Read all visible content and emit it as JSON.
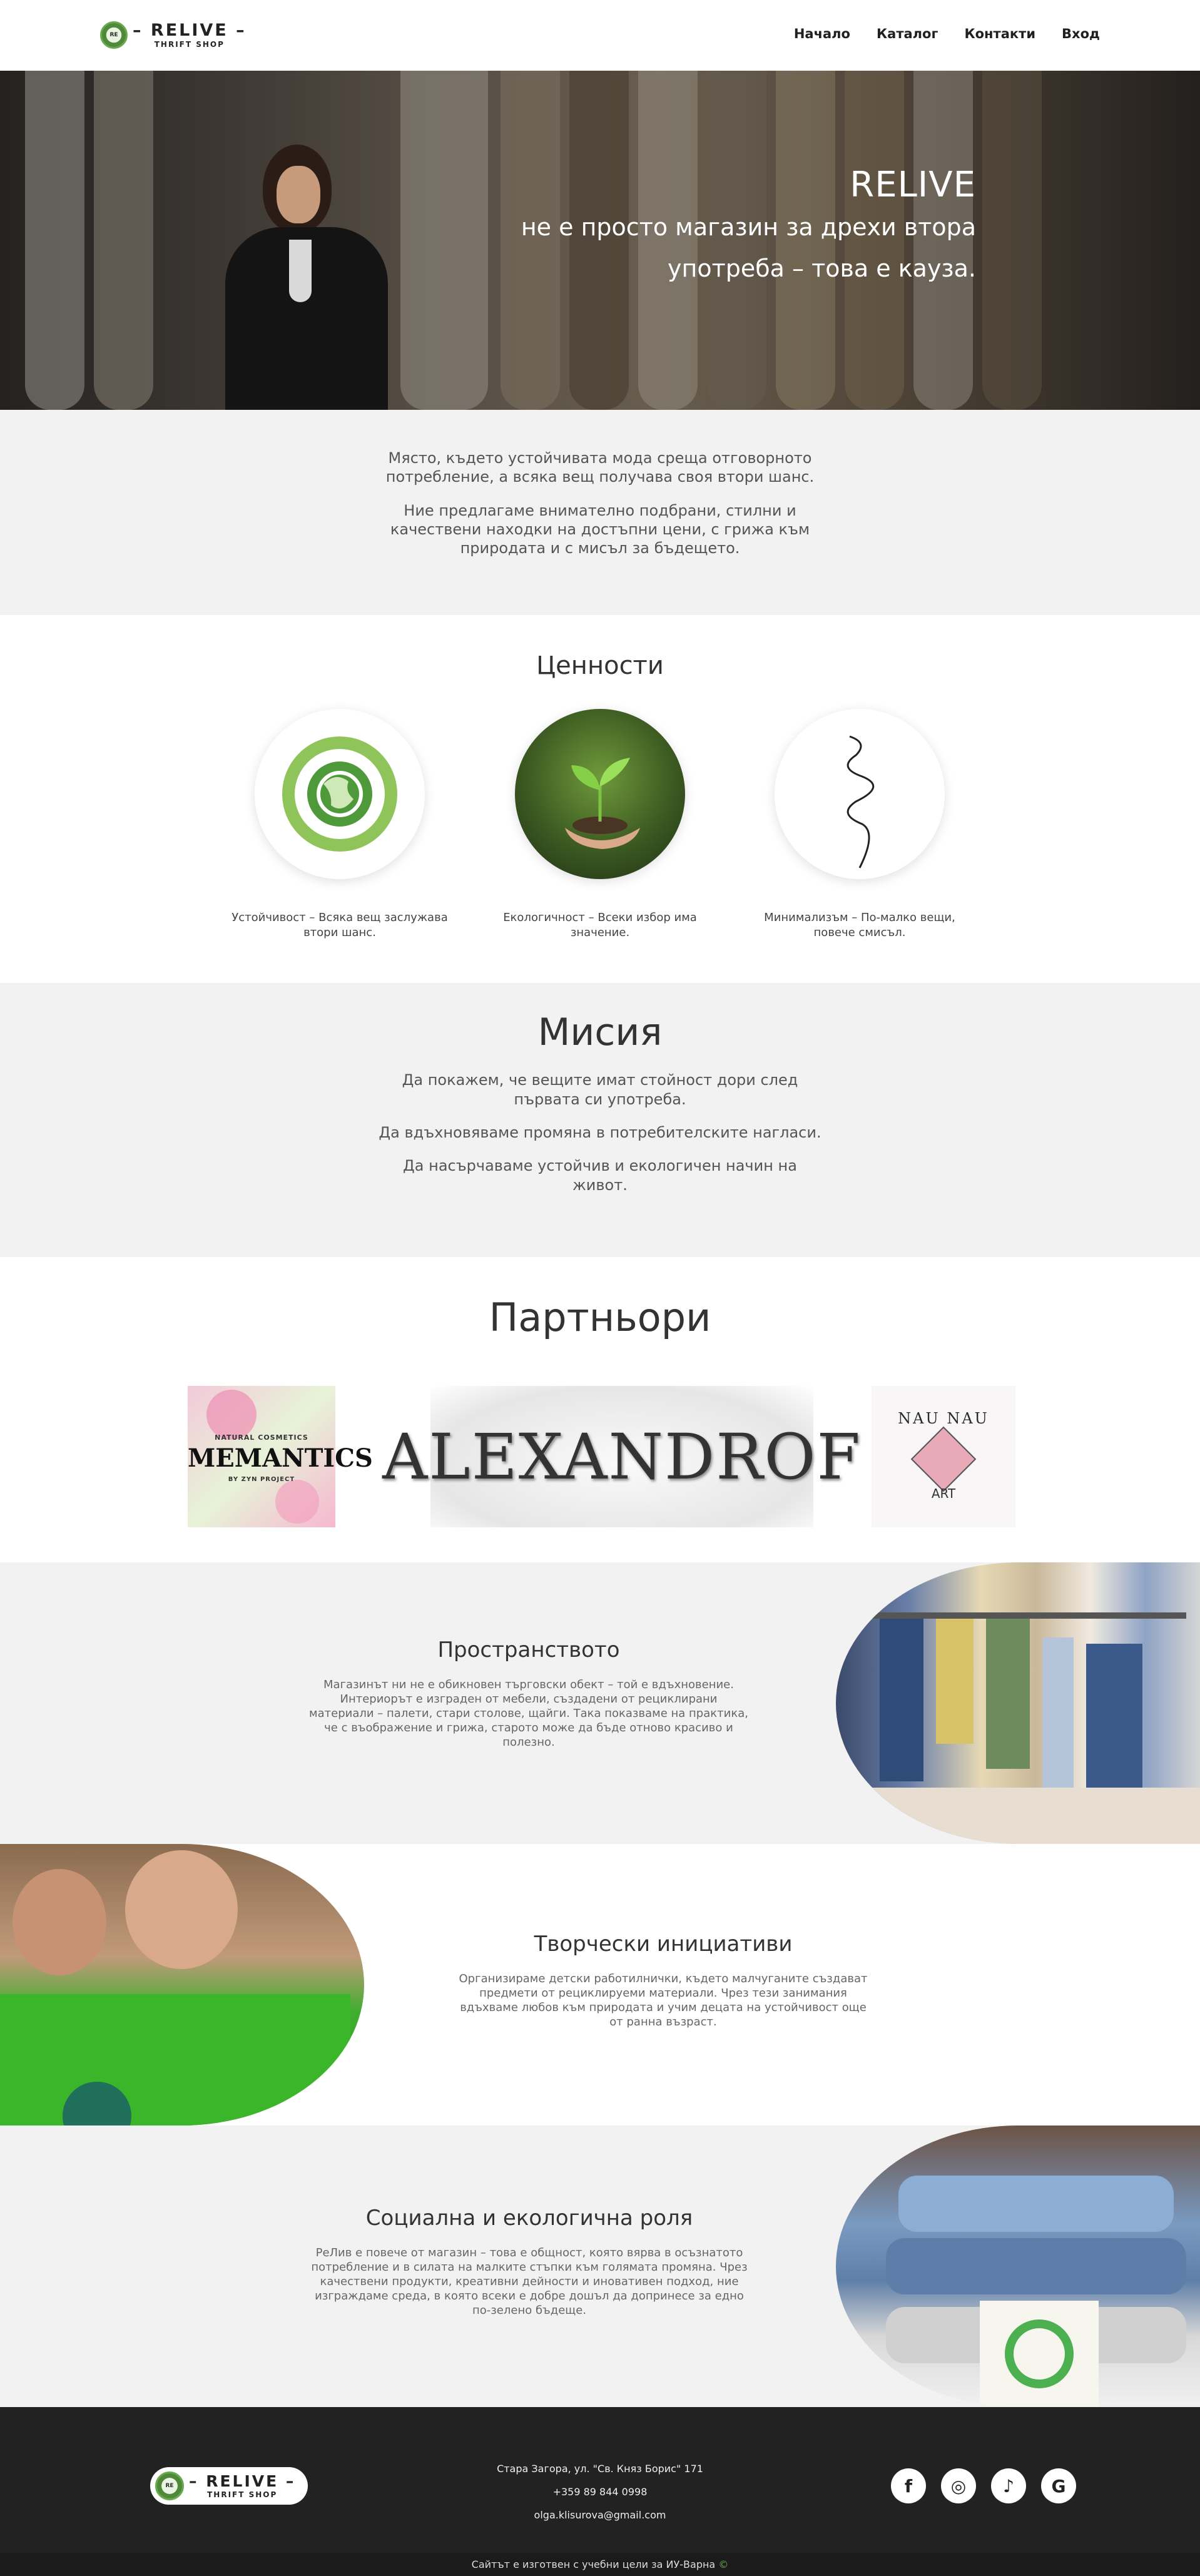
{
  "nav": {
    "logo_mark": "RE",
    "logo_big": "– RELIVE –",
    "logo_small": "THRIFT SHOP",
    "items": [
      {
        "label": "Начало"
      },
      {
        "label": "Каталог"
      },
      {
        "label": "Контакти"
      },
      {
        "label": "Вход"
      }
    ]
  },
  "hero": {
    "brand": "RELIVE",
    "tagline_1": "не е просто магазин за дрехи втора",
    "tagline_2": "употреба – това е кауза."
  },
  "intro": {
    "p1": "Място, където устойчивата мода среща отговорното потребление, а всяка вещ получава своя втори шанс.",
    "p2": "Ние предлагаме внимателно подбрани, стилни и качествени находки на достъпни цени, с грижа към природата и с мисъл за бъдещето."
  },
  "values": {
    "title": "Ценности",
    "items": [
      {
        "label": "Устойчивост – Всяка вещ заслужава втори шанс."
      },
      {
        "label": "Екологичност – Всеки избор има значение."
      },
      {
        "label": "Минимализъм – По-малко вещи, повече смисъл."
      }
    ]
  },
  "mission": {
    "title": "Мисия",
    "p1": "Да покажем, че вещите имат стойност дори след първата си употреба.",
    "p2": "Да вдъхновяваме промяна в потребителските нагласи.",
    "p3": "Да насърчаваме устойчив и екологичен начин на живот."
  },
  "partners": {
    "title": "Партньори",
    "memantics_top": "NATURAL COSMETICS",
    "memantics_name": "MEMANTICS",
    "memantics_sub": "BY ZYN PROJECT",
    "alexandrof": "ALEXANDROF",
    "art_top": "NAU NAU",
    "art_bottom": "ART"
  },
  "space": {
    "title": "Пространството",
    "text": "Магазинът ни не е обикновен търговски обект – той е вдъхновение. Интериорът е изграден от мебели, създадени от рециклирани материали – палети, стари столове, щайги. Така показваме на практика, че с въображение и грижа, старото може да бъде отново красиво и полезно."
  },
  "creative": {
    "title": "Творчески инициативи",
    "text": "Организираме детски работилнички, където малчуганите създават предмети от рециклируеми материали. Чрез тези занимания вдъхваме любов към природата и учим децата на устойчивост още от ранна възраст."
  },
  "social": {
    "title": "Социална и екологична роля",
    "text": "РеЛив е повече от магазин – това е общност, която вярва в осъзнатото потребление и в силата на малките стъпки към голямата промяна. Чрез качествени продукти, креативни дейности и иновативен подход, ние изграждаме среда, в която всеки е добре дошъл да допринесе за едно по-зелено бъдеще."
  },
  "footer": {
    "address": "Стара Загора, ул. \"Св. Княз Борис\" 171",
    "phone": "+359 89 844 0998",
    "email": "olga.klisurova@gmail.com",
    "socials": [
      {
        "icon": "facebook-icon",
        "glyph": "f"
      },
      {
        "icon": "instagram-icon",
        "glyph": "◎"
      },
      {
        "icon": "tiktok-icon",
        "glyph": "♪"
      },
      {
        "icon": "google-icon",
        "glyph": "G"
      }
    ],
    "bottom_text": "Сайтът е изготвен с учебни цели за ИУ-Варна",
    "bottom_mark": "©"
  }
}
